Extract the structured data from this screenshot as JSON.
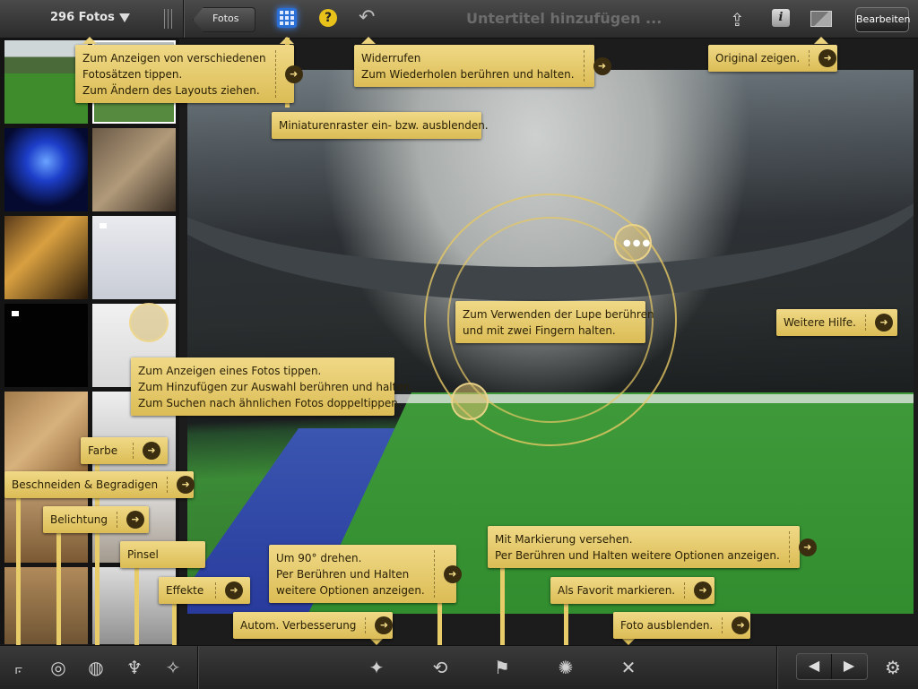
{
  "toolbar": {
    "photo_count": "296 Fotos",
    "back_label": "Fotos",
    "help_label": "?",
    "undo_label": "↶",
    "subtitle_placeholder": "Untertitel hinzufügen ...",
    "edit_label": "Bearbeiten",
    "info_label": "i"
  },
  "tips": {
    "sets": "Zum Anzeigen von verschiedenen\nFotosätzen tippen.\nZum Ändern des Layouts ziehen.",
    "undo": "Widerrufen\nZum Wiederholen berühren und halten.",
    "original": "Original zeigen.",
    "grid": "Miniaturenraster ein- bzw. ausblenden.",
    "loupe": "Zum Verwenden der Lupe berühren\nund mit zwei Fingern halten.",
    "more_help": "Weitere Hilfe.",
    "photo_tap": "Zum Anzeigen eines Fotos tippen.\nZum Hinzufügen zur Auswahl berühren und halten.\nZum Suchen nach ähnlichen Fotos doppeltippen.",
    "color": "Farbe",
    "crop": "Beschneiden & Begradigen",
    "exposure": "Belichtung",
    "brush": "Pinsel",
    "effects": "Effekte",
    "rotate": "Um 90° drehen.\nPer Berühren und Halten\nweitere Optionen anzeigen.",
    "flag": "Mit Markierung versehen.\nPer Berühren und Halten weitere Optionen anzeigen.",
    "favorite": "Als Favorit markieren.",
    "auto_enhance": "Autom. Verbesserung",
    "hide": "Foto ausblenden."
  },
  "icons": {
    "arrow": "➜",
    "crop": "⟔",
    "exposure": "◎",
    "color": "◍",
    "brush": "♆",
    "effects": "✧",
    "auto_enhance": "✦",
    "rotate": "⟲",
    "flag": "⚑",
    "favorite": "✺",
    "hide": "✕",
    "prev": "◀",
    "next": "▶",
    "settings": "⚙",
    "share": "⇪"
  },
  "colors": {
    "tip": "#dbbc55",
    "accent": "#2a6fd6"
  }
}
